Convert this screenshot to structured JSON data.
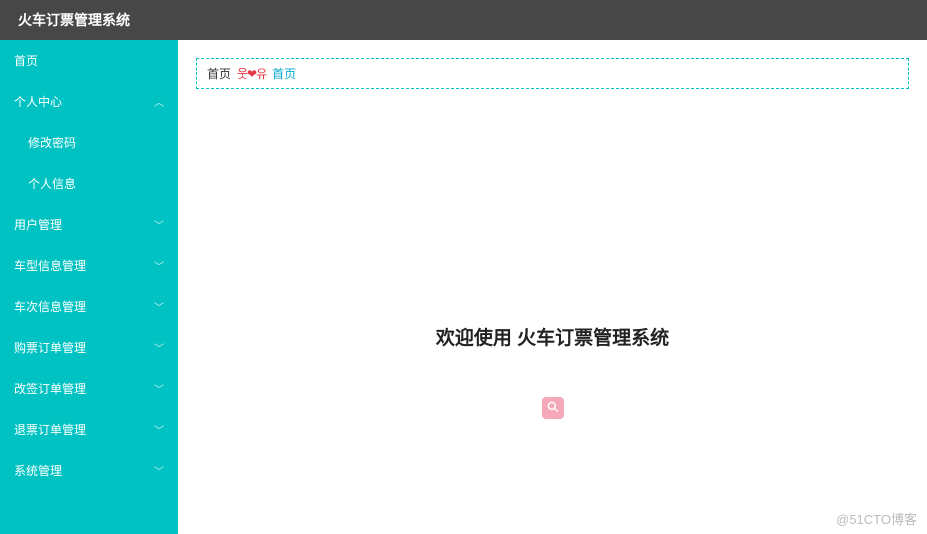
{
  "header": {
    "title": "火车订票管理系统"
  },
  "sidebar": {
    "items": [
      {
        "label": "首页",
        "expandable": false
      },
      {
        "label": "个人中心",
        "expandable": true,
        "expanded": true,
        "children": [
          {
            "label": "修改密码"
          },
          {
            "label": "个人信息"
          }
        ]
      },
      {
        "label": "用户管理",
        "expandable": true,
        "expanded": false
      },
      {
        "label": "车型信息管理",
        "expandable": true,
        "expanded": false
      },
      {
        "label": "车次信息管理",
        "expandable": true,
        "expanded": false
      },
      {
        "label": "购票订单管理",
        "expandable": true,
        "expanded": false
      },
      {
        "label": "改签订单管理",
        "expandable": true,
        "expanded": false
      },
      {
        "label": "退票订单管理",
        "expandable": true,
        "expanded": false
      },
      {
        "label": "系统管理",
        "expandable": true,
        "expanded": false
      }
    ]
  },
  "breadcrumb": {
    "home": "首页",
    "middle": "웃❤유",
    "link": "首页"
  },
  "main": {
    "welcome": "欢迎使用 火车订票管理系统"
  },
  "watermark": "@51CTO博客",
  "colors": {
    "headerBg": "#474747",
    "sidebarBg": "#00c2c2",
    "breadcrumbBorder": "#00c2c2",
    "linkColor": "#00a8cc",
    "zoomBg": "#f5a9b8"
  }
}
